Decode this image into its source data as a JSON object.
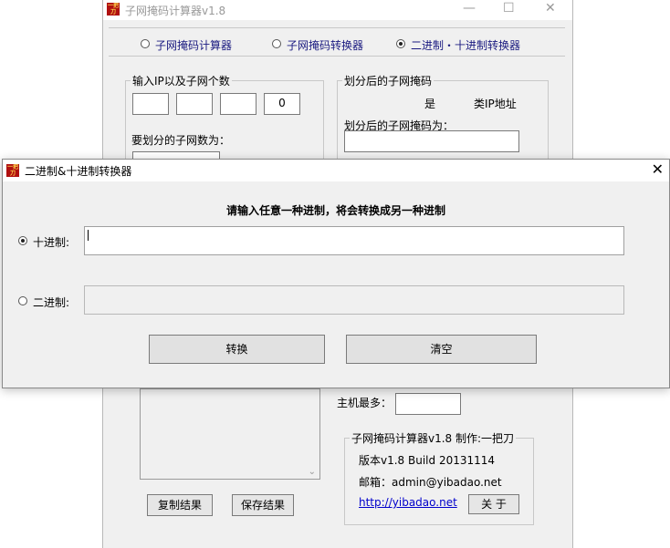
{
  "main_window": {
    "title": "子网掩码计算器v1.8",
    "app_icon_text": "一把刀",
    "modes": [
      {
        "label": "子网掩码计算器",
        "selected": false
      },
      {
        "label": "子网掩码转换器",
        "selected": false
      },
      {
        "label": "二进制・十进制转换器",
        "selected": true
      }
    ],
    "ip_group": {
      "legend": "输入IP以及子网个数",
      "octets": [
        "",
        "",
        "",
        "0"
      ],
      "subnet_count_label": "要划分的子网数为："
    },
    "mask_group": {
      "legend": "划分后的子网掩码",
      "is_label": "是",
      "class_label": "类IP地址",
      "mask_label": "划分后的子网掩码为："
    },
    "host_max_label": "主机最多：",
    "copy_button": "复制结果",
    "save_button": "保存结果",
    "about_group": {
      "legend": "子网掩码计算器v1.8  制作:一把刀",
      "version": "版本v1.8  Build 20131114",
      "email": "邮箱：admin@yibadao.net",
      "link": "http://yibadao.net",
      "about_button": "关  于"
    }
  },
  "dialog": {
    "title": "二进制&十进制转换器",
    "prompt": "请输入任意一种进制，将会转换成另一种进制",
    "decimal_label": "十进制:",
    "decimal_selected": true,
    "decimal_value": "",
    "binary_label": "二进制:",
    "binary_selected": false,
    "binary_value": "",
    "convert_button": "转换",
    "clear_button": "清空"
  },
  "colors": {
    "window_bg": "#f0f0f0",
    "link": "#0000cc",
    "mode_text": "#1a1a80"
  }
}
